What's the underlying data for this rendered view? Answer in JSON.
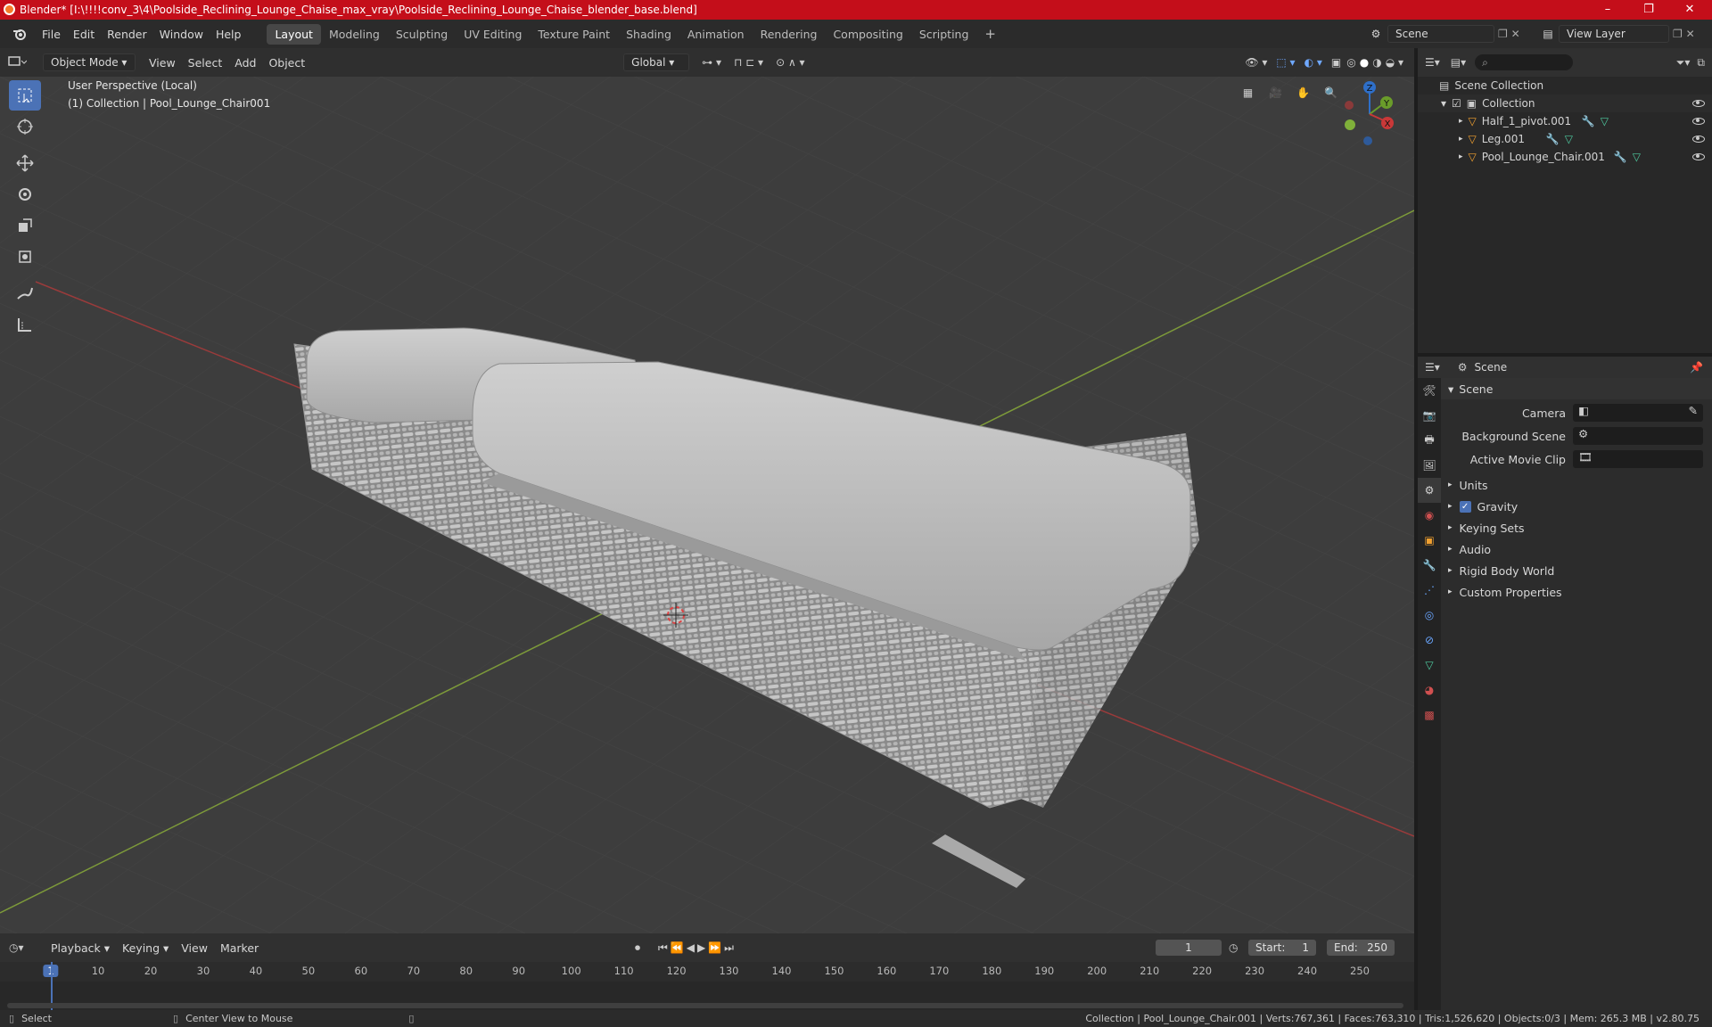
{
  "window": {
    "title": "Blender* [I:\\!!!!conv_3\\4\\Poolside_Reclining_Lounge_Chaise_max_vray\\Poolside_Reclining_Lounge_Chaise_blender_base.blend]",
    "minimize": "–",
    "maximize": "❐",
    "close": "✕"
  },
  "menu": {
    "items": [
      "File",
      "Edit",
      "Render",
      "Window",
      "Help"
    ]
  },
  "workspaces": {
    "tabs": [
      "Layout",
      "Modeling",
      "Sculpting",
      "UV Editing",
      "Texture Paint",
      "Shading",
      "Animation",
      "Rendering",
      "Compositing",
      "Scripting"
    ],
    "active": "Layout",
    "add": "+"
  },
  "scene_selector": {
    "scene": "Scene",
    "view_layer": "View Layer"
  },
  "viewport_header": {
    "mode": "Object Mode",
    "menus": [
      "View",
      "Select",
      "Add",
      "Object"
    ],
    "orientation": "Global"
  },
  "viewport": {
    "perspective": "User Perspective (Local)",
    "collection": "(1) Collection | Pool_Lounge_Chair001",
    "gizmo": {
      "x": "X",
      "y": "Y",
      "z": "Z"
    }
  },
  "outliner": {
    "root": "Scene Collection",
    "collection": "Collection",
    "objects": [
      {
        "name": "Half_1_pivot.001"
      },
      {
        "name": "Leg.001"
      },
      {
        "name": "Pool_Lounge_Chair.001"
      }
    ]
  },
  "properties": {
    "header": "Scene",
    "panel": "Scene",
    "fields": {
      "camera": "Camera",
      "background_scene": "Background Scene",
      "active_movie_clip": "Active Movie Clip"
    },
    "sections": [
      "Units",
      "Gravity",
      "Keying Sets",
      "Audio",
      "Rigid Body World",
      "Custom Properties"
    ],
    "gravity_checked": true
  },
  "timeline": {
    "menus": [
      "Playback",
      "Keying",
      "View",
      "Marker"
    ],
    "current_frame": "1",
    "start_label": "Start:",
    "start": "1",
    "end_label": "End:",
    "end": "250",
    "ticks": [
      "1",
      "10",
      "20",
      "30",
      "40",
      "50",
      "60",
      "70",
      "80",
      "90",
      "100",
      "110",
      "120",
      "130",
      "140",
      "150",
      "160",
      "170",
      "180",
      "190",
      "200",
      "210",
      "220",
      "230",
      "240",
      "250"
    ]
  },
  "statusbar": {
    "select": "Select",
    "center": "Center View to Mouse",
    "info": "Collection | Pool_Lounge_Chair.001 | Verts:767,361 | Faces:763,310 | Tris:1,526,620 | Objects:0/3 | Mem: 265.3 MB | v2.80.75"
  }
}
